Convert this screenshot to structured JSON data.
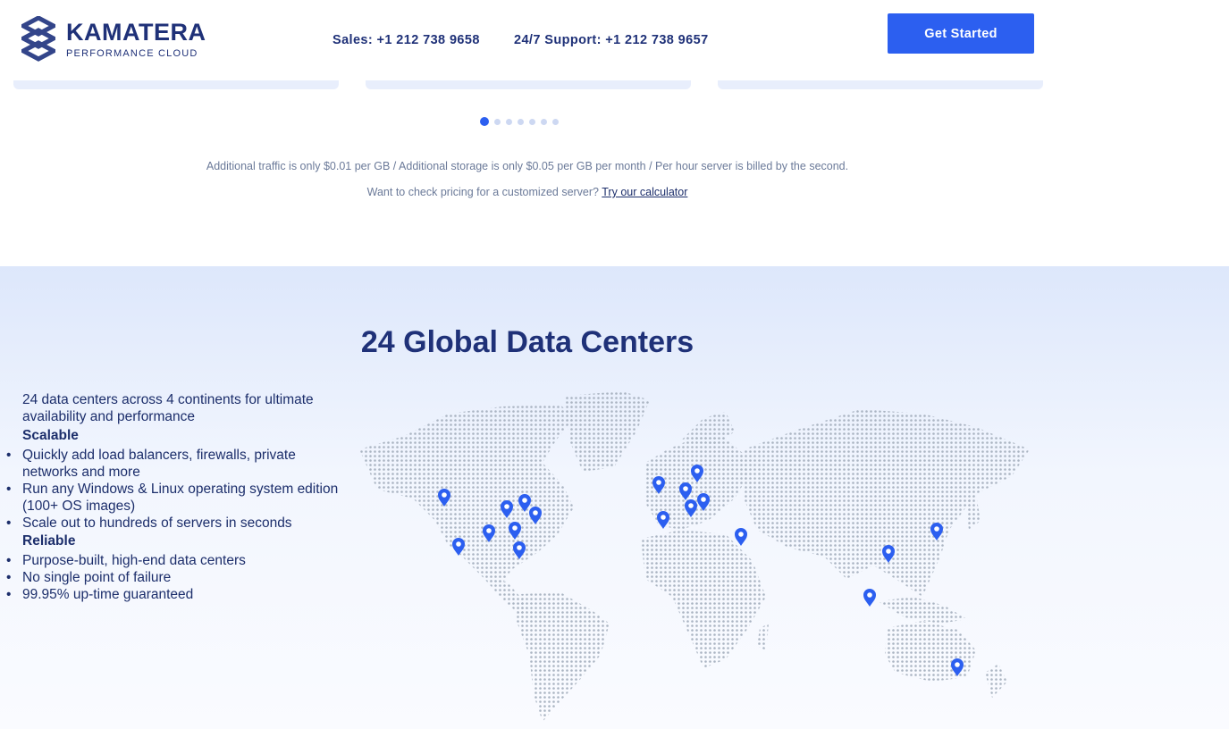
{
  "header": {
    "brand": "KAMATERA",
    "tagline": "PERFORMANCE CLOUD",
    "sales": "Sales: +1 212 738 9658",
    "support": "24/7 Support: +1 212 738 9657",
    "cta": "Get Started"
  },
  "carousel": {
    "active_index": 0,
    "total": 7
  },
  "pricing": {
    "note": "Additional traffic is only $0.01 per GB / Additional storage is only $0.05 per GB per month / Per hour server is billed by the second.",
    "calc_prompt": "Want to check pricing for a customized server?",
    "calc_link": "Try our calculator"
  },
  "datacenters": {
    "title": "24 Global Data Centers",
    "intro": "24 data centers across 4 continents for ultimate availability and performance",
    "groups": [
      {
        "heading": "Scalable",
        "items": [
          "Quickly add load balancers, firewalls, private networks and more",
          "Run any Windows & Linux operating system edition (100+ OS images)",
          "Scale out to hundreds of servers in seconds"
        ]
      },
      {
        "heading": "Reliable",
        "items": [
          "Purpose-built, high-end data centers",
          "No single point of failure",
          "99.95% up-time guaranteed"
        ]
      }
    ]
  },
  "colors": {
    "brand_navy": "#1f3178",
    "accent_blue": "#2c5ff0",
    "map_dot": "#aab4c2",
    "inactive_dot": "#cdd8f2"
  },
  "icons": {
    "logo": "kamatera-logo-icon",
    "pin": "map-pin-icon"
  }
}
